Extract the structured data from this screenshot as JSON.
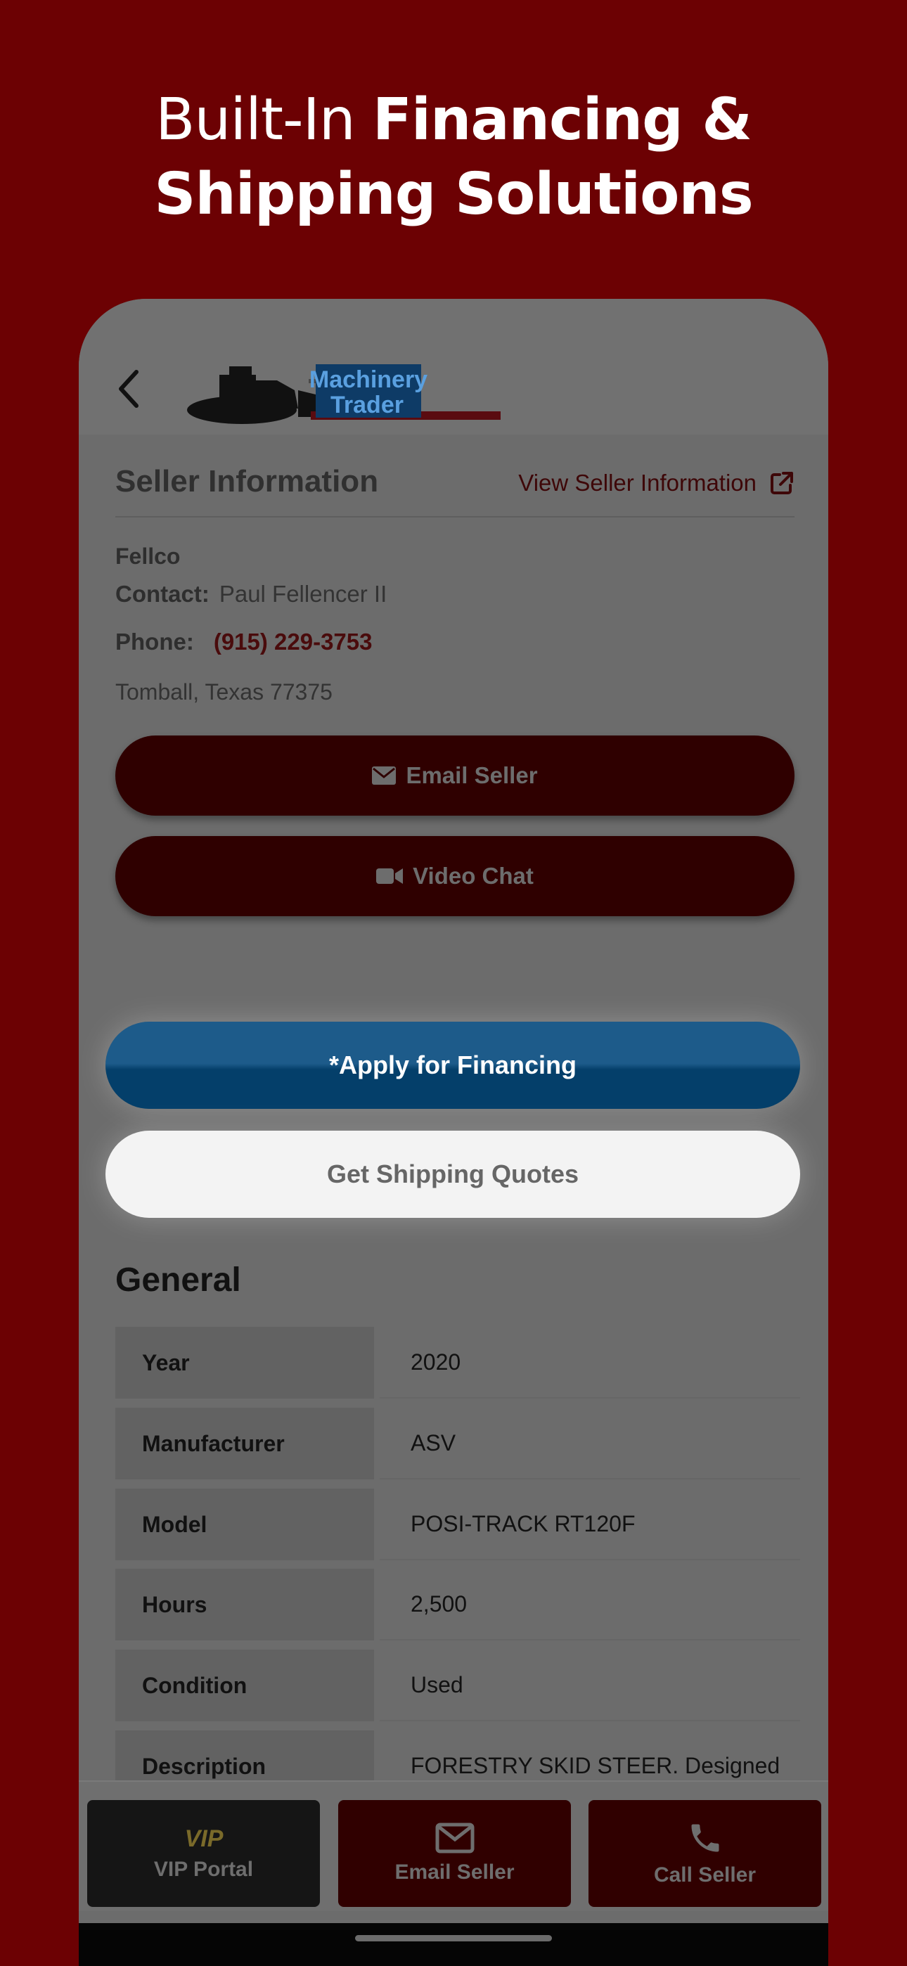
{
  "headline": {
    "line1_light": "Built-In ",
    "line1_bold": "Financing &",
    "line2_bold": "Shipping Solutions"
  },
  "app": {
    "logo_text_1": "Machinery",
    "logo_text_2": "Trader"
  },
  "seller": {
    "section_title": "Seller Information",
    "view_link": "View Seller Information",
    "name": "Fellco",
    "contact_label": "Contact:",
    "contact_value": "Paul Fellencer II",
    "phone_label": "Phone:",
    "phone_value": "(915) 229-3753",
    "location": "Tomball, Texas 77375",
    "email_button": "Email Seller",
    "video_button": "Video Chat"
  },
  "actions": {
    "financing": "*Apply for Financing",
    "shipping": "Get Shipping Quotes"
  },
  "general": {
    "title": "General",
    "rows": [
      {
        "key": "Year",
        "value": "2020"
      },
      {
        "key": "Manufacturer",
        "value": "ASV"
      },
      {
        "key": "Model",
        "value": "POSI-TRACK RT120F"
      },
      {
        "key": "Hours",
        "value": "2,500"
      },
      {
        "key": "Condition",
        "value": "Used"
      },
      {
        "key": "Description",
        "value": "FORESTRY SKID STEER.  Designed"
      }
    ]
  },
  "bottom_nav": {
    "vip_badge": "VIP",
    "vip": "VIP Portal",
    "email": "Email Seller",
    "call": "Call Seller"
  },
  "colors": {
    "background": "#6c0103",
    "financing_button": "#1d5b8a",
    "dark_button": "#2f0000"
  }
}
